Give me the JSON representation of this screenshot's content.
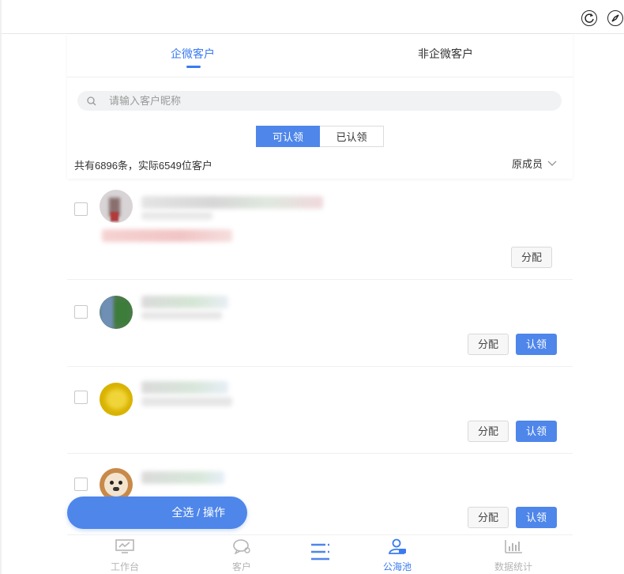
{
  "tabs": [
    {
      "label": "企微客户",
      "active": true
    },
    {
      "label": "非企微客户",
      "active": false
    }
  ],
  "search": {
    "placeholder": "请输入客户昵称"
  },
  "segment": [
    {
      "label": "可认领",
      "active": true
    },
    {
      "label": "已认领",
      "active": false
    }
  ],
  "summary": {
    "count_text": "共有6896条，实际6549位客户"
  },
  "filter": {
    "owner_label": "原成员"
  },
  "actions": {
    "assign_label": "分配",
    "claim_label": "认领"
  },
  "fab": {
    "label": "全选 / 操作"
  },
  "bottom_nav": [
    {
      "label": "工作台",
      "icon": "dashboard-icon",
      "active": false
    },
    {
      "label": "客户",
      "icon": "customer-chat-icon",
      "active": false
    },
    {
      "label": "",
      "icon": "menu-icon",
      "active": false
    },
    {
      "label": "公海池",
      "icon": "public-pool-icon",
      "active": true
    },
    {
      "label": "数据统计",
      "icon": "bar-chart-icon",
      "active": false
    }
  ],
  "colors": {
    "accent": "#4e86ea",
    "tab_active": "#3a7bf0",
    "muted": "#b5b5b5"
  }
}
